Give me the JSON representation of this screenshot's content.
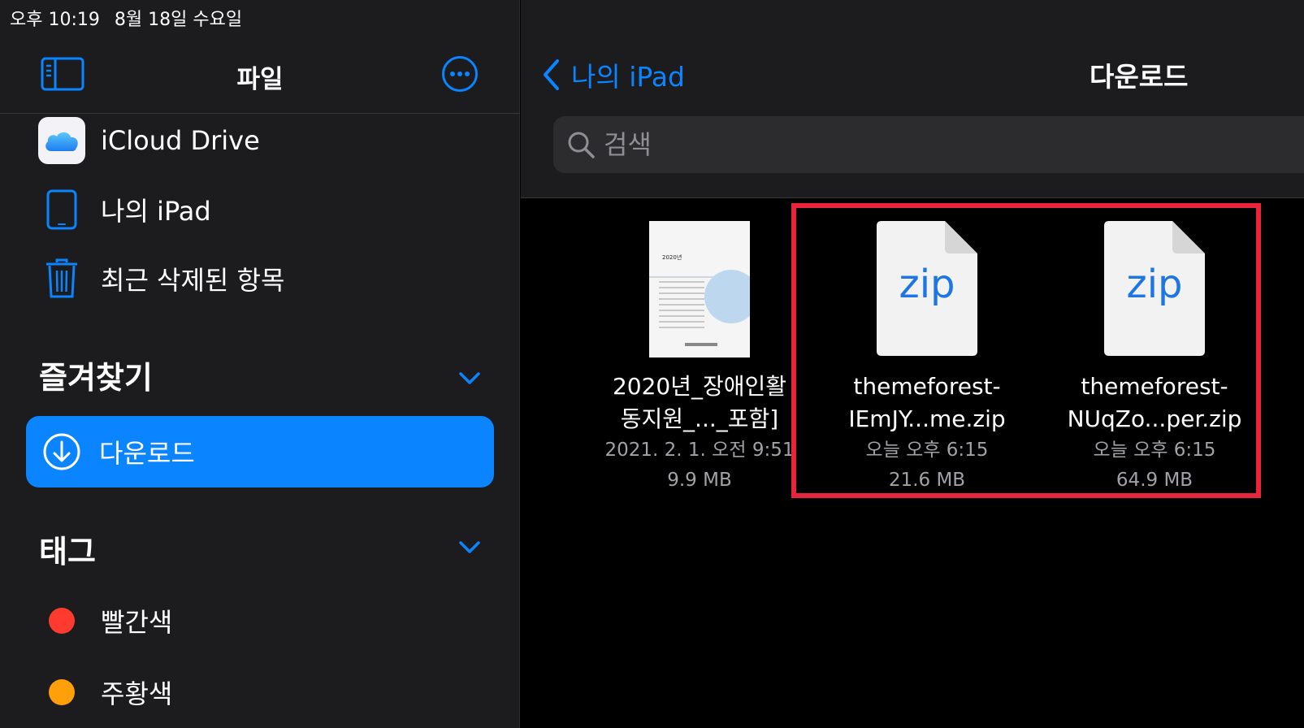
{
  "status_bar": {
    "time": "오후 10:19",
    "date": "8월 18일 수요일"
  },
  "sidebar": {
    "title": "파일",
    "locations": [
      {
        "label": "iCloud Drive",
        "icon": "icloud-icon"
      },
      {
        "label": "나의 iPad",
        "icon": "ipad-icon"
      },
      {
        "label": "최근 삭제된 항목",
        "icon": "trash-icon"
      }
    ],
    "favorites": {
      "title": "즐겨찾기",
      "items": [
        {
          "label": "다운로드",
          "icon": "download-icon",
          "selected": true
        }
      ]
    },
    "tags": {
      "title": "태그",
      "items": [
        {
          "label": "빨간색",
          "color": "#ff3b30"
        },
        {
          "label": "주황색",
          "color": "#ff9f0a"
        }
      ]
    }
  },
  "main": {
    "back_label": "나의 iPad",
    "title": "다운로드",
    "search_placeholder": "검색",
    "files": [
      {
        "name_line1": "2020년_장애인활",
        "name_line2": "동지원_..._포함]",
        "date": "2021. 2. 1. 오전 9:51",
        "size": "9.9 MB",
        "thumb_text": "2020년",
        "kind": "pdf"
      },
      {
        "name_line1": "themeforest-",
        "name_line2": "IEmJY...me.zip",
        "date": "오늘 오후 6:15",
        "size": "21.6 MB",
        "kind": "zip",
        "thumb_text": "zip"
      },
      {
        "name_line1": "themeforest-",
        "name_line2": "NUqZo...per.zip",
        "date": "오늘 오후 6:15",
        "size": "64.9 MB",
        "kind": "zip",
        "thumb_text": "zip"
      }
    ]
  },
  "colors": {
    "accent": "#0a84ff",
    "highlight": "#e8253d",
    "sidebar_bg": "#1c1c1e"
  }
}
